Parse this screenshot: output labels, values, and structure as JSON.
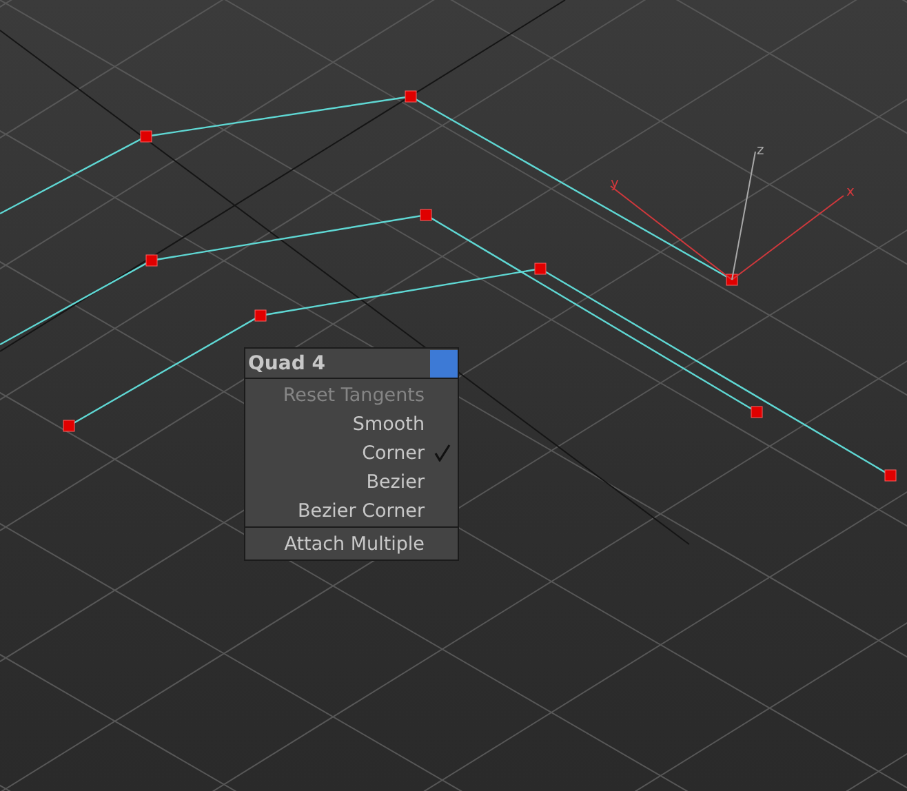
{
  "gizmo": {
    "axes": [
      {
        "label": "x",
        "kind": "x"
      },
      {
        "label": "y",
        "kind": "y"
      },
      {
        "label": "z",
        "kind": "z"
      }
    ]
  },
  "quad_menu": {
    "title": "Quad 4",
    "sections": [
      {
        "items": [
          {
            "label": "Reset Tangents",
            "disabled": true,
            "checked": false
          },
          {
            "label": "Smooth",
            "disabled": false,
            "checked": false
          },
          {
            "label": "Corner",
            "disabled": false,
            "checked": true
          },
          {
            "label": "Bezier",
            "disabled": false,
            "checked": false
          },
          {
            "label": "Bezier Corner",
            "disabled": false,
            "checked": false
          }
        ]
      },
      {
        "items": [
          {
            "label": "Attach Multiple",
            "disabled": false,
            "checked": false
          }
        ]
      }
    ]
  }
}
